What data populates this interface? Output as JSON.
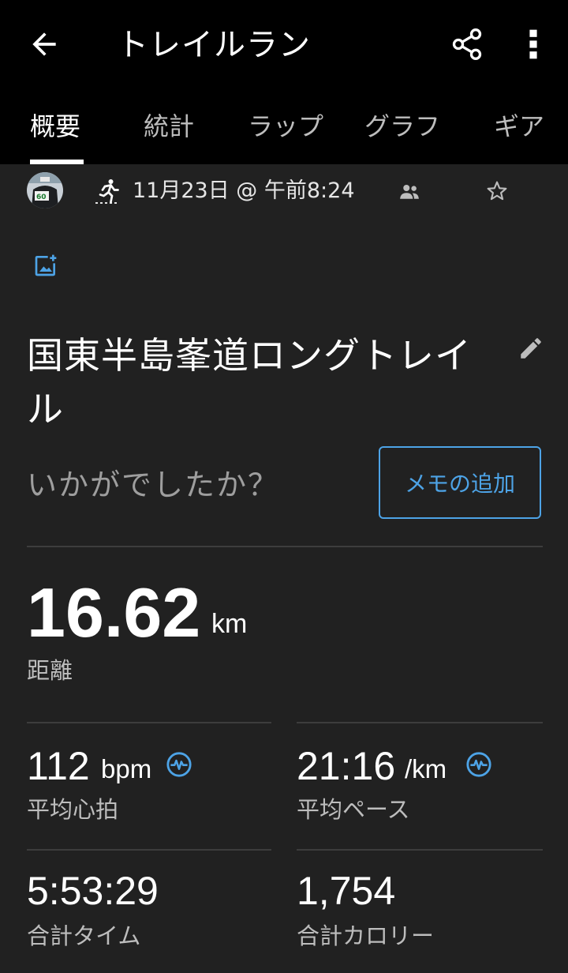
{
  "header": {
    "title": "トレイルラン",
    "icons": [
      "back-arrow-icon",
      "share-icon",
      "more-vert-icon"
    ]
  },
  "tabs": [
    {
      "label": "概要",
      "active": true
    },
    {
      "label": "統計",
      "active": false
    },
    {
      "label": "ラップ",
      "active": false
    },
    {
      "label": "グラフ",
      "active": false
    },
    {
      "label": "ギア",
      "active": false
    }
  ],
  "activity": {
    "date": "11月23日 @ 午前8:24",
    "name": "国東半島峯道ロングトレイル",
    "prompt": "いかがでしたか？",
    "memo_button": "メモの追加"
  },
  "distance": {
    "value": "16.62",
    "unit": "km",
    "label": "距離"
  },
  "stats": {
    "avg_hr": {
      "value": "112",
      "unit": "bpm",
      "label": "平均心拍"
    },
    "avg_pace": {
      "value": "21:16",
      "unit": "/km",
      "label": "平均ペース"
    },
    "total_time": {
      "value": "5:53:29",
      "label": "合計タイム"
    },
    "total_calories": {
      "value": "1,754",
      "label": "合計カロリー"
    }
  },
  "colors": {
    "accent": "#4da3e6",
    "background": "#212121",
    "topbar": "#000000"
  }
}
